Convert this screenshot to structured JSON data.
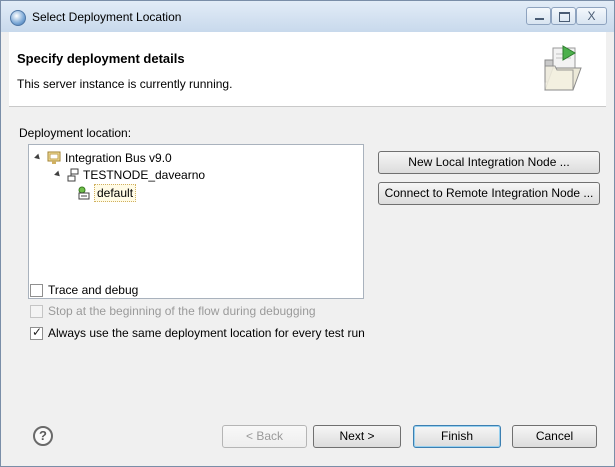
{
  "window": {
    "title": "Select Deployment Location",
    "close_glyph": "X"
  },
  "header": {
    "title": "Specify deployment details",
    "description": "This server instance is currently running."
  },
  "deployment": {
    "label": "Deployment location:",
    "tree": [
      {
        "label": "Integration Bus v9.0",
        "icon": "integration-bus-icon",
        "expanded": true
      },
      {
        "label": "TESTNODE_davearno",
        "icon": "integration-node-icon",
        "expanded": true
      },
      {
        "label": "default",
        "icon": "integration-server-icon",
        "selected": true
      }
    ],
    "new_local_button": "New Local Integration Node ...",
    "connect_remote_button": "Connect to Remote Integration Node ..."
  },
  "options": {
    "trace": {
      "label": "Trace and debug",
      "checked": false
    },
    "stop": {
      "label": "Stop at the beginning of the flow during debugging",
      "checked": false,
      "enabled": false
    },
    "always": {
      "label": "Always use the same deployment location for every test run",
      "checked": true
    }
  },
  "footer": {
    "help_glyph": "?",
    "back": "< Back",
    "next": "Next >",
    "finish": "Finish",
    "cancel": "Cancel"
  },
  "colors": {
    "accent": "#3c7fb1",
    "title_bar": "#c8d9ec",
    "header_bg": "#ffffff"
  }
}
